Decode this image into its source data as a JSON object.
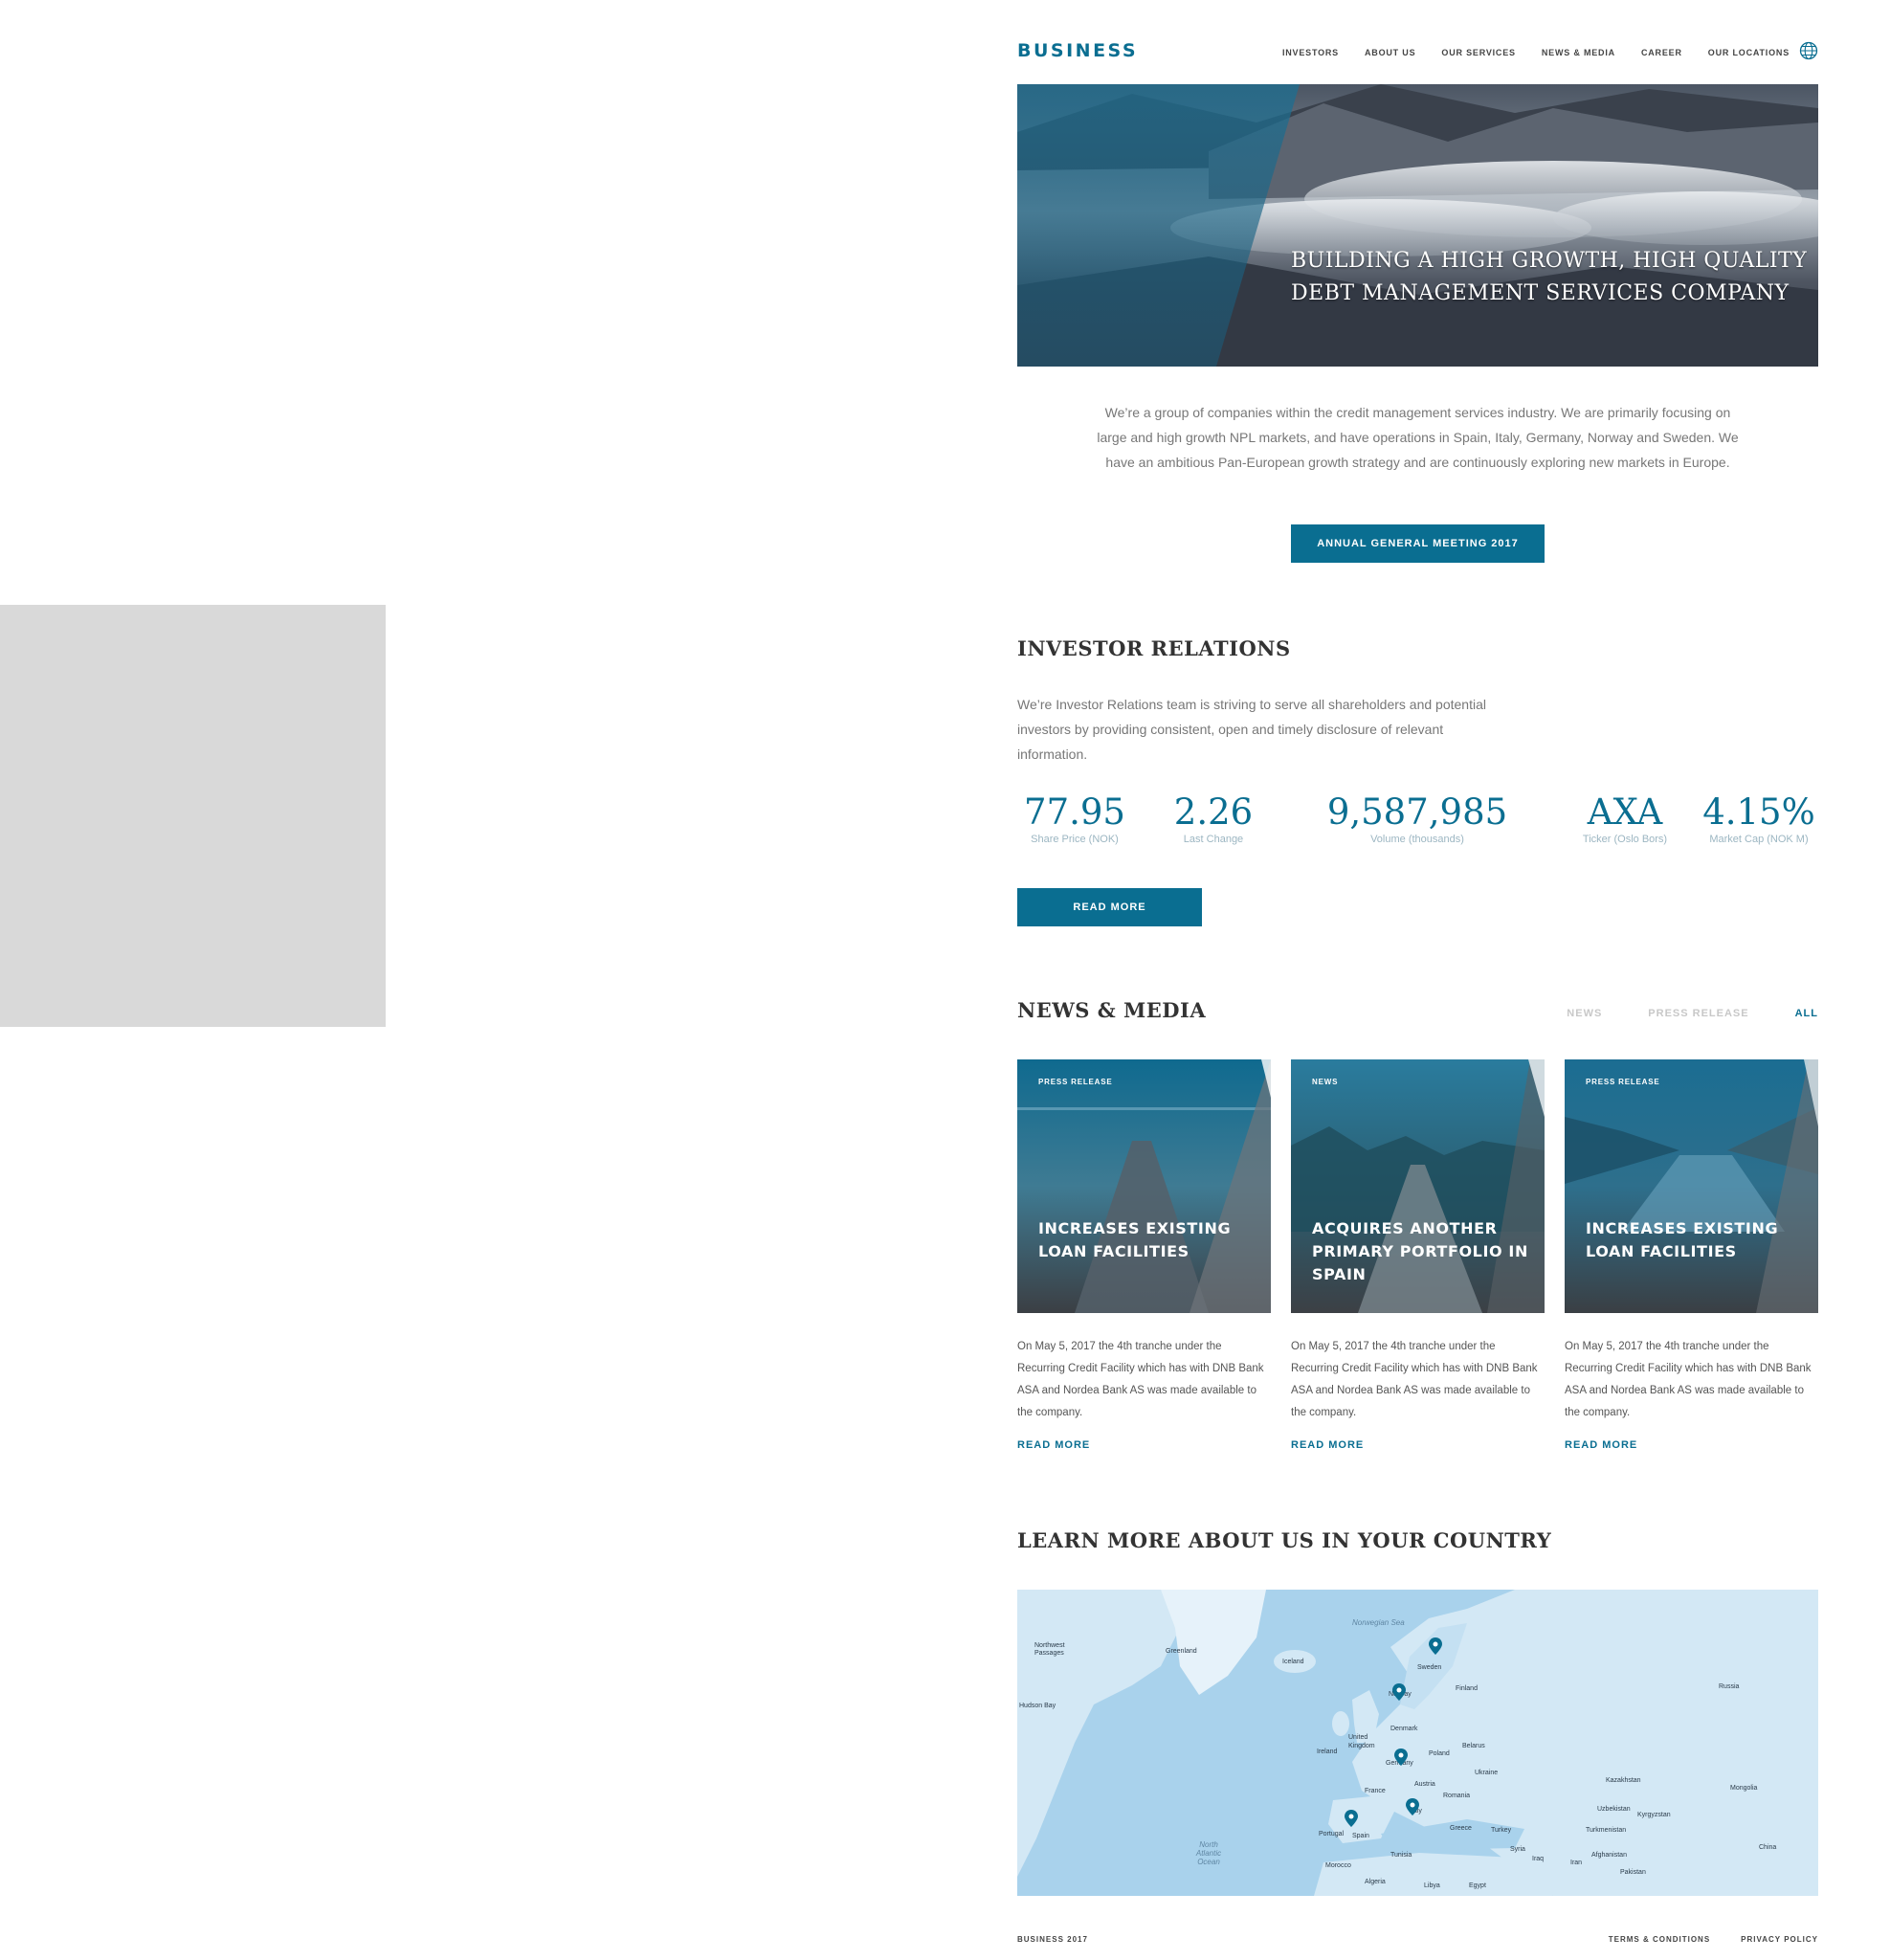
{
  "brand": {
    "logo": "BUSINESS",
    "accent": "#0a6e91"
  },
  "nav": [
    "INVESTORS",
    "ABOUT US",
    "OUR SERVICES",
    "NEWS & MEDIA",
    "CAREER",
    "OUR LOCATIONS"
  ],
  "hero": {
    "line1": "BUILDING A HIGH GROWTH, HIGH QUALITY",
    "line2": "DEBT MANAGEMENT SERVICES COMPANY"
  },
  "intro": {
    "text": "We’re a group of companies within the credit management services industry. We are primarily focusing on large and high growth NPL markets, and have operations in Spain, Italy, Germany, Norway and Sweden. We have an ambitious Pan-European growth strategy and are continuously exploring new markets in Europe.",
    "button": "ANNUAL GENERAL MEETING 2017"
  },
  "investor": {
    "title": "INVESTOR RELATIONS",
    "text": "We’re Investor Relations team is striving to serve all shareholders and potential investors by providing consistent, open and timely disclosure of relevant information.",
    "stats": [
      {
        "value": "77.95",
        "label": "Share Price (NOK)"
      },
      {
        "value": "2.26",
        "label": "Last Change"
      },
      {
        "value": "9,587,985",
        "label": "Volume (thousands)"
      },
      {
        "value": "AXA",
        "label": "Ticker (Oslo Bors)"
      },
      {
        "value": "4.15%",
        "label": "Market Cap (NOK M)"
      }
    ],
    "button": "READ MORE"
  },
  "news": {
    "title": "NEWS & MEDIA",
    "filters": [
      "NEWS",
      "PRESS RELEASE",
      "ALL"
    ],
    "cards": [
      {
        "tag": "PRESS RELEASE",
        "heading": "INCREASES EXISTING LOAN FACILITIES",
        "text": "On May 5,  2017 the 4th tranche under the Recurring Credit Facility which has with DNB Bank ASA and Nordea Bank AS was made available to the company.",
        "link": "READ MORE"
      },
      {
        "tag": "NEWS",
        "heading": "ACQUIRES ANOTHER PRIMARY PORTFOLIO IN SPAIN",
        "text": "On May 5,  2017 the 4th tranche under the Recurring Credit Facility which  has with DNB Bank ASA and Nordea Bank AS was made available to the company.",
        "link": "READ MORE"
      },
      {
        "tag": "PRESS RELEASE",
        "heading": "INCREASES EXISTING LOAN FACILITIES",
        "text": "On May 5,  2017 the 4th tranche under the Recurring Credit Facility which  has with DNB Bank ASA and Nordea Bank AS was made available to the company.",
        "link": "READ MORE"
      }
    ]
  },
  "country": {
    "title": "LEARN MORE ABOUT US IN YOUR COUNTRY",
    "map_labels": [
      "Greenland",
      "Iceland",
      "Norwegian Sea",
      "Sweden",
      "Finland",
      "Norway",
      "Russia",
      "Denmark",
      "United Kingdom",
      "Ireland",
      "Germany",
      "Poland",
      "Belarus",
      "France",
      "Ukraine",
      "Austria",
      "Romania",
      "Italy",
      "Kazakhstan",
      "Mongolia",
      "Portugal",
      "Spain",
      "Greece",
      "Turkey",
      "Uzbekistan",
      "Kyrgyzstan",
      "Turkmenistan",
      "Afghanistan",
      "China",
      "Syria",
      "Iraq",
      "Iran",
      "Pakistan",
      "Morocco",
      "Tunisia",
      "Algeria",
      "Libya",
      "Egypt",
      "Hudson Bay",
      "Northwest Passages",
      "North Atlantic Ocean"
    ]
  },
  "footer": {
    "left": "BUSINESS 2017",
    "links": [
      "TERMS & CONDITIONS",
      "PRIVACY POLICY"
    ]
  }
}
